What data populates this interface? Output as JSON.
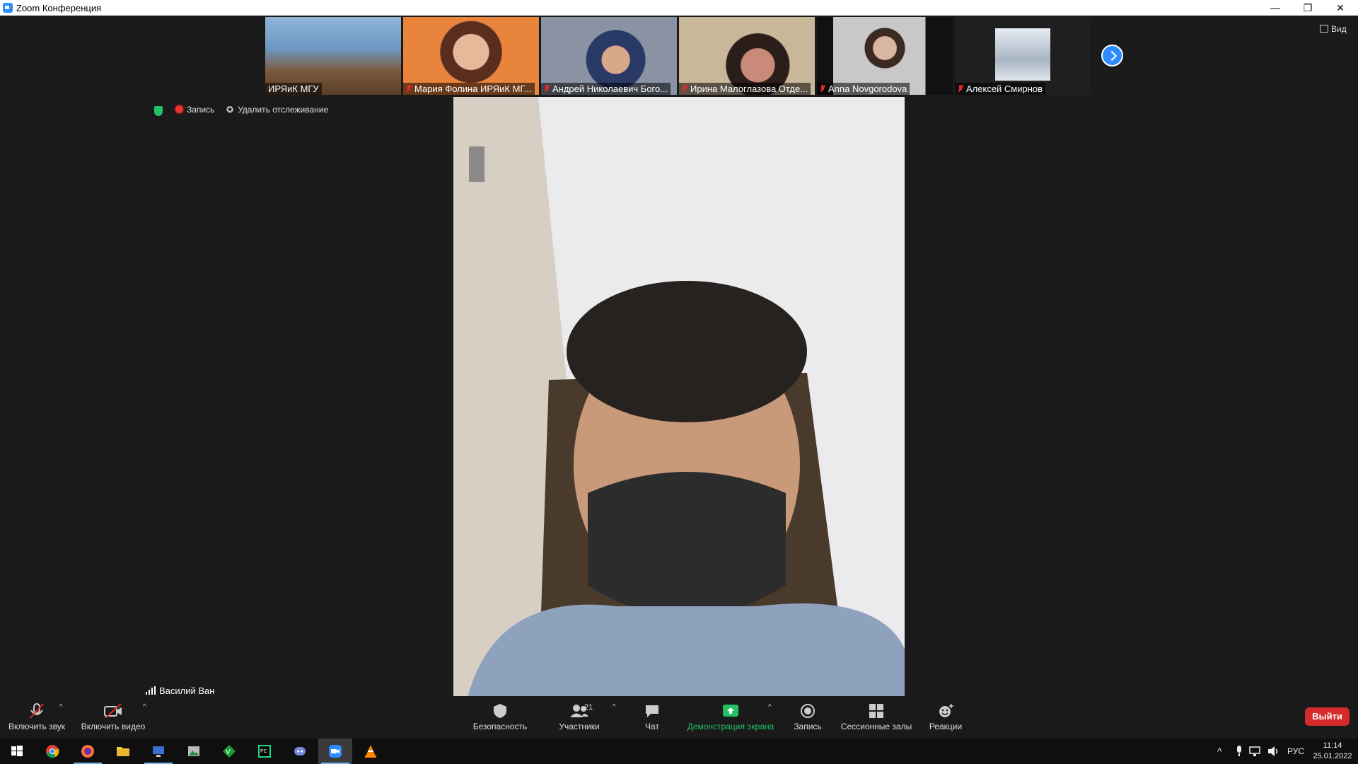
{
  "window": {
    "title": "Zoom Конференция"
  },
  "gallery": [
    {
      "name": "ИРЯиК МГУ",
      "muted": false
    },
    {
      "name": "Мария Фолина ИРЯиК МГ...",
      "muted": true
    },
    {
      "name": "Андрей Николаевич Бого...",
      "muted": true
    },
    {
      "name": "Ирина Малоглазова Отде...",
      "muted": true
    },
    {
      "name": "Anna Novgorodova",
      "muted": true
    },
    {
      "name": "Алексей Смирнов",
      "muted": true
    }
  ],
  "view_button": "Вид",
  "status_bar": {
    "recording": "Запись",
    "remove_tracking": "Удалить отслеживание"
  },
  "active_speaker": {
    "name": "Василий Ван"
  },
  "toolbar": {
    "unmute": "Включить звук",
    "start_video": "Включить видео",
    "security": "Безопасность",
    "participants": "Участники",
    "participants_count": "21",
    "chat": "Чат",
    "share_screen": "Демонстрация экрана",
    "record": "Запись",
    "breakout_rooms": "Сессионные залы",
    "reactions": "Реакции",
    "leave": "Выйти"
  },
  "taskbar": {
    "language": "РУС",
    "time": "11:14",
    "date": "25.01.2022"
  },
  "colors": {
    "accent": "#2d8cff",
    "danger": "#d62b2b",
    "share": "#21c164"
  }
}
